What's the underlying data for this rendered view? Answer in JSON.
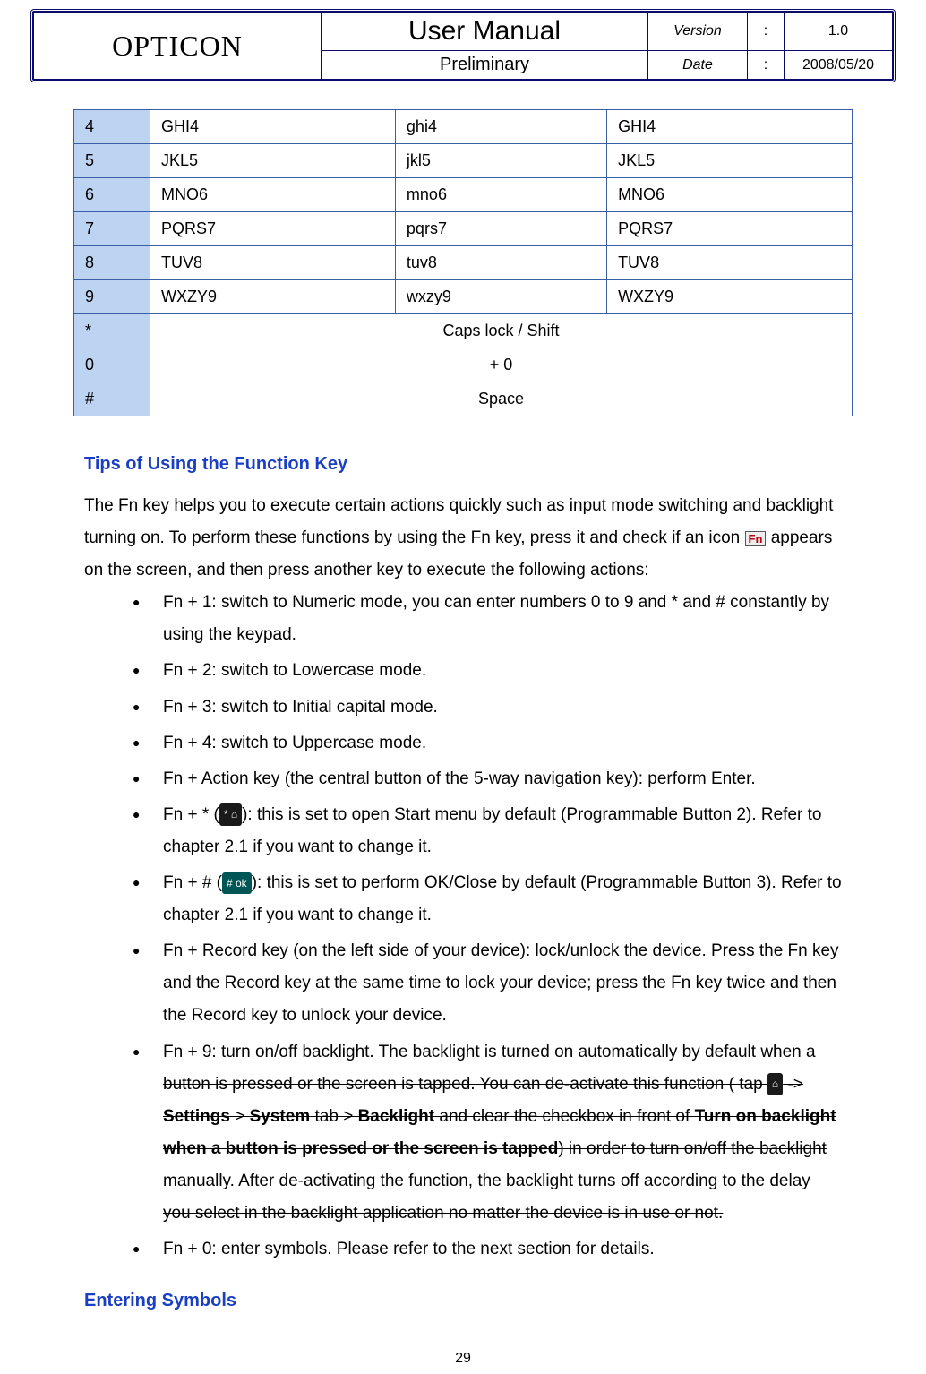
{
  "header": {
    "brand": "OPTICON",
    "title": "User Manual",
    "subtitle": "Preliminary",
    "version_label": "Version",
    "version_value": "1.0",
    "date_label": "Date",
    "date_value": "2008/05/20"
  },
  "key_table": {
    "rows": [
      {
        "key": "4",
        "c1": "GHI4",
        "c2": "ghi4",
        "c3": "GHI4"
      },
      {
        "key": "5",
        "c1": "JKL5",
        "c2": "jkl5",
        "c3": "JKL5"
      },
      {
        "key": "6",
        "c1": "MNO6",
        "c2": "mno6",
        "c3": "MNO6"
      },
      {
        "key": "7",
        "c1": "PQRS7",
        "c2": "pqrs7",
        "c3": "PQRS7"
      },
      {
        "key": "8",
        "c1": "TUV8",
        "c2": "tuv8",
        "c3": "TUV8"
      },
      {
        "key": "9",
        "c1": "WXZY9",
        "c2": "wxzy9",
        "c3": "WXZY9"
      }
    ],
    "merged_rows": [
      {
        "key": "*",
        "text": "Caps lock / Shift"
      },
      {
        "key": "0",
        "text": "+ 0"
      },
      {
        "key": "#",
        "text": "Space"
      }
    ]
  },
  "tips": {
    "title": "Tips of Using the Function Key",
    "intro_pre": "The Fn key helps you to execute certain actions quickly such as input mode switching and backlight turning on. To perform these functions by using the Fn key, press it and check if an icon ",
    "intro_fn_icon": "Fn",
    "intro_post": " appears on the screen, and then press another key to execute the following actions:",
    "bullets": [
      "Fn + 1: switch to Numeric mode, you can enter numbers 0 to 9 and * and # constantly by using the keypad.",
      "Fn + 2: switch to Lowercase mode.",
      "Fn + 3: switch to Initial capital mode.",
      "Fn + 4: switch to Uppercase mode.",
      "Fn + Action key (the central button of the 5-way navigation key): perform Enter."
    ],
    "star": {
      "pre": "Fn + * (",
      "icon": "* ⌂",
      "post": "): this is set to open Start menu by default (Programmable Button 2). Refer to chapter 2.1 if you want to change it."
    },
    "hash": {
      "pre": "Fn + # (",
      "icon": "# ok",
      "post": "): this is set to perform OK/Close by default (Programmable Button 3). Refer to chapter 2.1 if you want to change it."
    },
    "record": "Fn + Record key (on the left side of your device): lock/unlock the device. Press the Fn key and the Record key at the same time to lock your device; press the Fn key twice and then the Record key to unlock your device.",
    "fn9_deleted": {
      "part1": "Fn + 9: turn on/off backlight. The backlight is turned on automatically by default when a button is pressed or the screen is tapped. You can de-activate this function ( tap ",
      "icon": "⌂",
      "part2": " -> ",
      "settings": "Settings",
      "gt1": " > ",
      "system": "System",
      "tab_label": " tab > ",
      "backlight": "Backlight",
      "part3": " and clear the checkbox in front of ",
      "bold_turn": "Turn on backlight when a button is pressed or the screen is tapped",
      "part4": ") in order to turn on/off the backlight manually. After de-activating the function, the backlight turns off according to the delay you select in the backlight application no matter the device is in use or not."
    },
    "fn0": "Fn + 0: enter symbols. Please refer to the next section for details."
  },
  "symbols_title": "Entering Symbols",
  "page_number": "29"
}
